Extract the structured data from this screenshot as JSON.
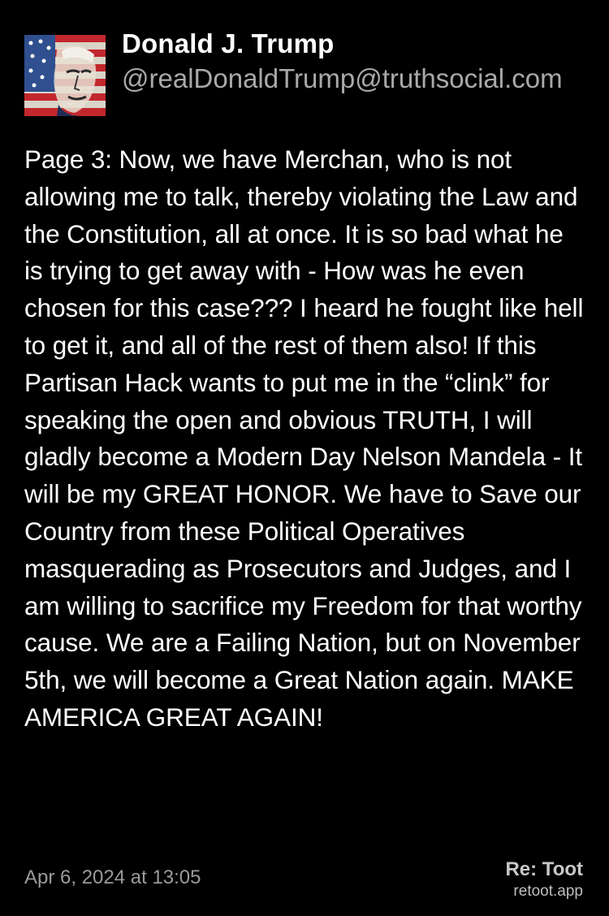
{
  "post": {
    "display_name": "Donald J. Trump",
    "handle": "@realDonaldTrump@truthsocial.com",
    "avatar_icon": "flag-portrait-avatar",
    "text": "Page 3: Now, we have Merchan, who is not allowing me to talk, thereby violating the Law and the Constitution, all at once. It is so bad what he is trying to get away with - How was he even chosen for this case??? I heard he fought like hell to get it, and all of the rest of them also! If this Partisan Hack wants to put me in the “clink” for speaking the open and obvious TRUTH, I will gladly become a Modern Day Nelson Mandela - It will be my GREAT HONOR. We have to Save our Country from these Political Operatives masquerading as Prosecutors and Judges, and I am willing to sacrifice my Freedom for that worthy cause. We are a Failing Nation, but on November 5th, we will become a Great Nation again. MAKE AMERICA GREAT AGAIN!",
    "timestamp": "Apr 6, 2024 at 13:05"
  },
  "watermark": {
    "title": "Re: Toot",
    "site": "retoot.app"
  },
  "colors": {
    "background": "#000000",
    "text": "#ffffff",
    "secondary_text": "#a9a9a9"
  }
}
